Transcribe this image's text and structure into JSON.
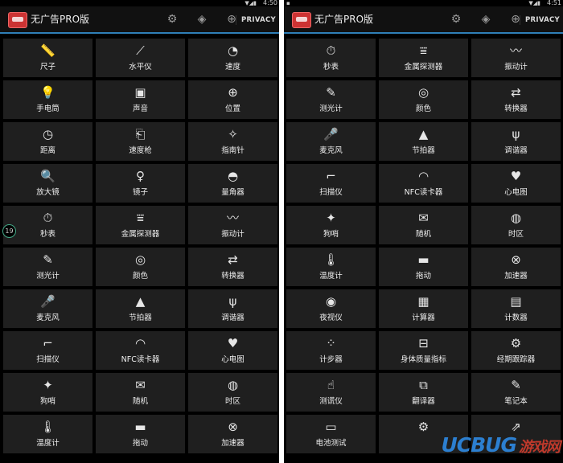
{
  "left": {
    "status": {
      "time": "4:50",
      "notif": "",
      "signal": "▼◢▮"
    },
    "actionbar": {
      "title": "无广告PRO版",
      "privacy": "PRIVACY"
    },
    "badge": "19",
    "tiles": [
      {
        "label": "尺子",
        "icon": "ruler-icon",
        "glyph": "📏"
      },
      {
        "label": "水平仪",
        "icon": "level-icon",
        "glyph": "⟋"
      },
      {
        "label": "速度",
        "icon": "speedometer-icon",
        "glyph": "◔"
      },
      {
        "label": "手电筒",
        "icon": "lightbulb-icon",
        "glyph": "💡"
      },
      {
        "label": "声音",
        "icon": "sound-meter-icon",
        "glyph": "▣"
      },
      {
        "label": "位置",
        "icon": "location-icon",
        "glyph": "⊕"
      },
      {
        "label": "距离",
        "icon": "distance-icon",
        "glyph": "◷"
      },
      {
        "label": "速度枪",
        "icon": "speed-gun-icon",
        "glyph": "⎗"
      },
      {
        "label": "指南针",
        "icon": "compass-icon",
        "glyph": "✧"
      },
      {
        "label": "放大镜",
        "icon": "magnifier-icon",
        "glyph": "🔍"
      },
      {
        "label": "镜子",
        "icon": "mirror-icon",
        "glyph": "♀"
      },
      {
        "label": "量角器",
        "icon": "protractor-icon",
        "glyph": "◓"
      },
      {
        "label": "秒表",
        "icon": "stopwatch-icon",
        "glyph": "⏱"
      },
      {
        "label": "金属探测器",
        "icon": "metal-detector-icon",
        "glyph": "⩸"
      },
      {
        "label": "振动计",
        "icon": "vibrometer-icon",
        "glyph": "〰"
      },
      {
        "label": "测光计",
        "icon": "light-meter-icon",
        "glyph": "✎"
      },
      {
        "label": "颜色",
        "icon": "color-icon",
        "glyph": "◎"
      },
      {
        "label": "转换器",
        "icon": "converter-icon",
        "glyph": "⇄"
      },
      {
        "label": "麦克风",
        "icon": "microphone-icon",
        "glyph": "🎤"
      },
      {
        "label": "节拍器",
        "icon": "metronome-icon",
        "glyph": "▲"
      },
      {
        "label": "调谐器",
        "icon": "tuner-icon",
        "glyph": "ψ"
      },
      {
        "label": "扫描仪",
        "icon": "scanner-icon",
        "glyph": "⌐"
      },
      {
        "label": "NFC读卡器",
        "icon": "nfc-icon",
        "glyph": "◠"
      },
      {
        "label": "心电图",
        "icon": "heart-rate-icon",
        "glyph": "♥"
      },
      {
        "label": "狗哨",
        "icon": "dog-whistle-icon",
        "glyph": "✦"
      },
      {
        "label": "随机",
        "icon": "random-icon",
        "glyph": "✉"
      },
      {
        "label": "时区",
        "icon": "timezone-icon",
        "glyph": "◍"
      },
      {
        "label": "温度计",
        "icon": "thermometer-icon",
        "glyph": "🌡"
      },
      {
        "label": "拖动",
        "icon": "car-icon",
        "glyph": "▬"
      },
      {
        "label": "加速器",
        "icon": "accelerometer-icon",
        "glyph": "⊗"
      }
    ]
  },
  "right": {
    "status": {
      "time": "4:51",
      "notif": "▪",
      "signal": "▼◢▮"
    },
    "actionbar": {
      "title": "无广告PRO版",
      "privacy": "PRIVACY"
    },
    "tiles": [
      {
        "label": "秒表",
        "icon": "stopwatch-icon",
        "glyph": "⏱"
      },
      {
        "label": "金属探测器",
        "icon": "metal-detector-icon",
        "glyph": "⩸"
      },
      {
        "label": "振动计",
        "icon": "vibrometer-icon",
        "glyph": "〰"
      },
      {
        "label": "测光计",
        "icon": "light-meter-icon",
        "glyph": "✎"
      },
      {
        "label": "颜色",
        "icon": "color-icon",
        "glyph": "◎"
      },
      {
        "label": "转换器",
        "icon": "converter-icon",
        "glyph": "⇄"
      },
      {
        "label": "麦克风",
        "icon": "microphone-icon",
        "glyph": "🎤"
      },
      {
        "label": "节拍器",
        "icon": "metronome-icon",
        "glyph": "▲"
      },
      {
        "label": "调谐器",
        "icon": "tuner-icon",
        "glyph": "ψ"
      },
      {
        "label": "扫描仪",
        "icon": "scanner-icon",
        "glyph": "⌐"
      },
      {
        "label": "NFC读卡器",
        "icon": "nfc-icon",
        "glyph": "◠"
      },
      {
        "label": "心电图",
        "icon": "heart-rate-icon",
        "glyph": "♥"
      },
      {
        "label": "狗哨",
        "icon": "dog-whistle-icon",
        "glyph": "✦"
      },
      {
        "label": "随机",
        "icon": "random-icon",
        "glyph": "✉"
      },
      {
        "label": "时区",
        "icon": "timezone-icon",
        "glyph": "◍"
      },
      {
        "label": "温度计",
        "icon": "thermometer-icon",
        "glyph": "🌡"
      },
      {
        "label": "拖动",
        "icon": "car-icon",
        "glyph": "▬"
      },
      {
        "label": "加速器",
        "icon": "accelerometer-icon",
        "glyph": "⊗"
      },
      {
        "label": "夜视仪",
        "icon": "night-vision-icon",
        "glyph": "◉"
      },
      {
        "label": "计算器",
        "icon": "calculator-icon",
        "glyph": "▦"
      },
      {
        "label": "计数器",
        "icon": "counter-icon",
        "glyph": "▤"
      },
      {
        "label": "计步器",
        "icon": "pedometer-icon",
        "glyph": "⁘"
      },
      {
        "label": "身体质量指标",
        "icon": "bmi-icon",
        "glyph": "⊟"
      },
      {
        "label": "经期跟踪器",
        "icon": "period-tracker-icon",
        "glyph": "⚙"
      },
      {
        "label": "测谎仪",
        "icon": "lie-detector-icon",
        "glyph": "☝"
      },
      {
        "label": "翻译器",
        "icon": "translator-icon",
        "glyph": "⧉"
      },
      {
        "label": "笔记本",
        "icon": "notebook-icon",
        "glyph": "✎"
      },
      {
        "label": "电池测试",
        "icon": "battery-icon",
        "glyph": "▭"
      },
      {
        "label": "",
        "icon": "settings-icon",
        "glyph": "⚙"
      },
      {
        "label": "",
        "icon": "share-icon",
        "glyph": "⇗"
      }
    ]
  },
  "watermark": {
    "brand": "UCBUG",
    "cn": "游戏网"
  }
}
